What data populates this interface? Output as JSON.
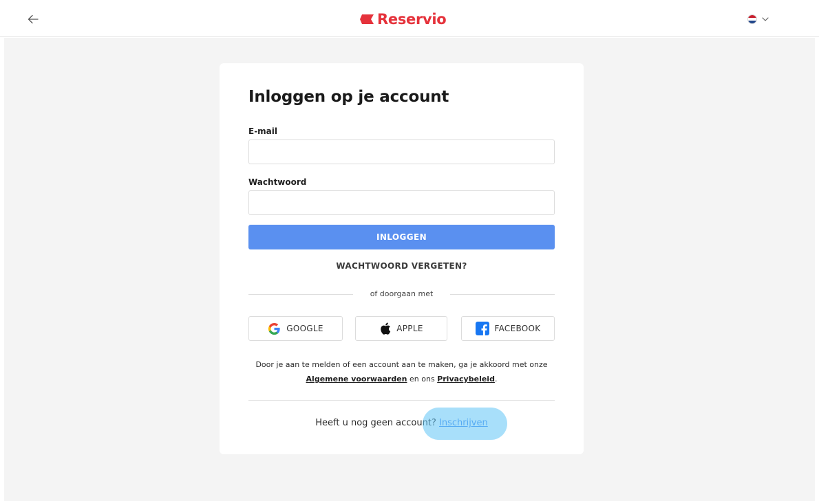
{
  "header": {
    "back_icon": "arrow-left-icon",
    "brand_name": "Reservio",
    "brand_color": "#e5323b",
    "language_flag": "netherlands-flag-icon",
    "language_chevron": "chevron-down-icon"
  },
  "login": {
    "title": "Inloggen op je account",
    "email_label": "E-mail",
    "email_value": "",
    "password_label": "Wachtwoord",
    "password_value": "",
    "login_button": "INLOGGEN",
    "login_button_color": "#5a90f0",
    "forgot_password": "WACHTWOORD VERGETEN?",
    "divider_text": "of doorgaan met",
    "social": [
      {
        "label": "GOOGLE",
        "icon": "google-icon"
      },
      {
        "label": "APPLE",
        "icon": "apple-icon"
      },
      {
        "label": "FACEBOOK",
        "icon": "facebook-icon"
      }
    ],
    "terms": {
      "prefix": "Door je aan te melden of een account aan te maken, ga je akkoord met onze",
      "terms_link": "Algemene voorwaarden",
      "middle": " en ons ",
      "privacy_link": "Privacybeleid",
      "suffix": "."
    },
    "signup": {
      "question": "Heeft u nog geen account? ",
      "link": "Inschrijven"
    }
  }
}
